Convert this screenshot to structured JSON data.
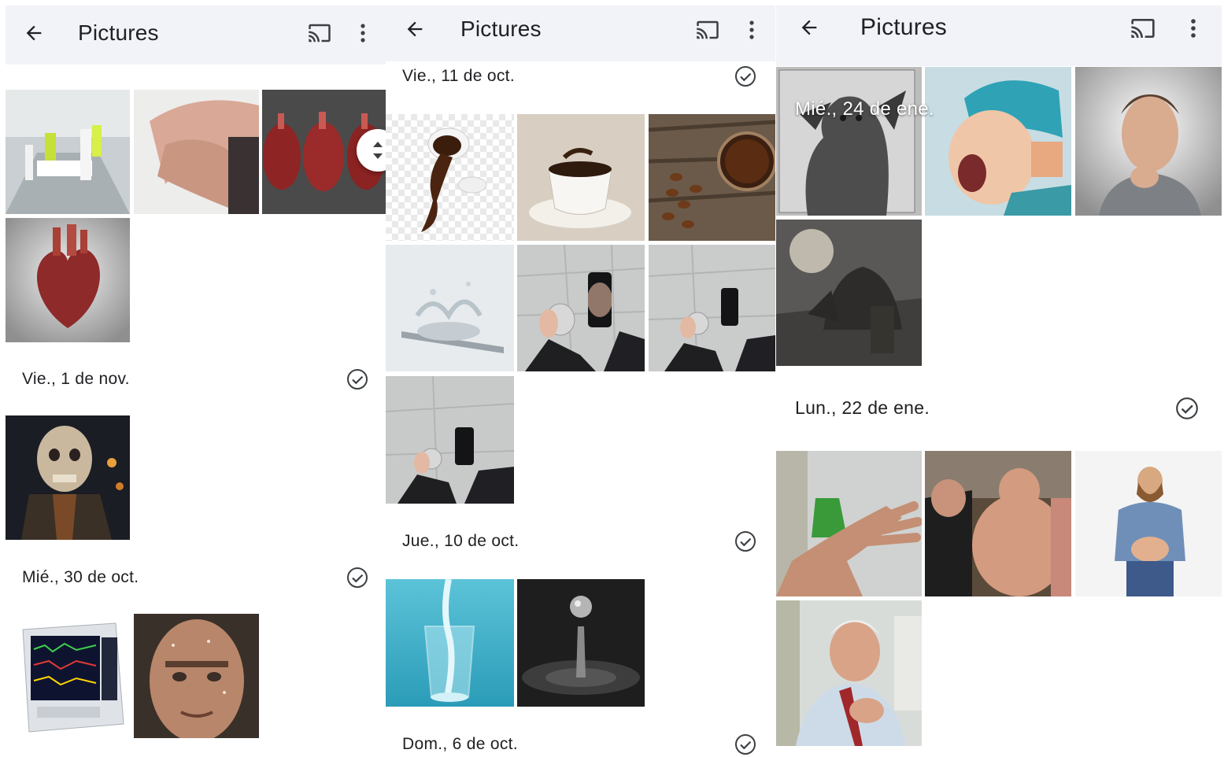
{
  "app": {
    "title": "Pictures",
    "icons": {
      "back": "arrow-back-icon",
      "cast": "cast-icon",
      "more": "more-vert-icon",
      "check": "check-circle-icon",
      "scroll": "fast-scroll-handle"
    }
  },
  "colors": {
    "appbar": "#f1f3f8",
    "text": "#202124",
    "icon": "#3c4043"
  },
  "panels": [
    {
      "title": "Pictures",
      "sections": [
        {
          "date": "Vie., 1 de nov."
        },
        {
          "date": "Mié., 30 de oct."
        }
      ],
      "thumbnails": [
        "hospital-corridor-photo",
        "cpr-hands-photo",
        "anatomical-hearts-photo",
        "anatomical-heart-photo",
        "zombie-portrait-photo",
        "patient-monitor-photo",
        "sweating-man-photo"
      ]
    },
    {
      "title": "Pictures",
      "sections": [
        {
          "date": "Vie., 11 de oct."
        },
        {
          "date": "Jue., 10 de oct."
        },
        {
          "date": "Dom., 6 de oct."
        }
      ],
      "thumbnails": [
        "coffee-splash-photo",
        "coffee-cup-spill-photo",
        "coffee-beans-photo",
        "water-spoon-splash-photo",
        "hands-phone-glass-photo",
        "hands-phone-glass-photo",
        "hands-phone-glass-photo",
        "water-glass-pour-photo",
        "water-drop-photo"
      ]
    },
    {
      "title": "Pictures",
      "overlay_date": "Mié., 24 de ene.",
      "sections": [
        {
          "date": "Lun., 22 de ene."
        }
      ],
      "thumbnails": [
        "gargoyle-drawing-photo",
        "screaming-surgeon-photo",
        "thinking-man-photo",
        "gargoyles-moon-drawing-photo",
        "hand-wall-photo",
        "shirtless-men-photo",
        "man-belly-photo",
        "man-chest-pain-photo"
      ]
    }
  ]
}
